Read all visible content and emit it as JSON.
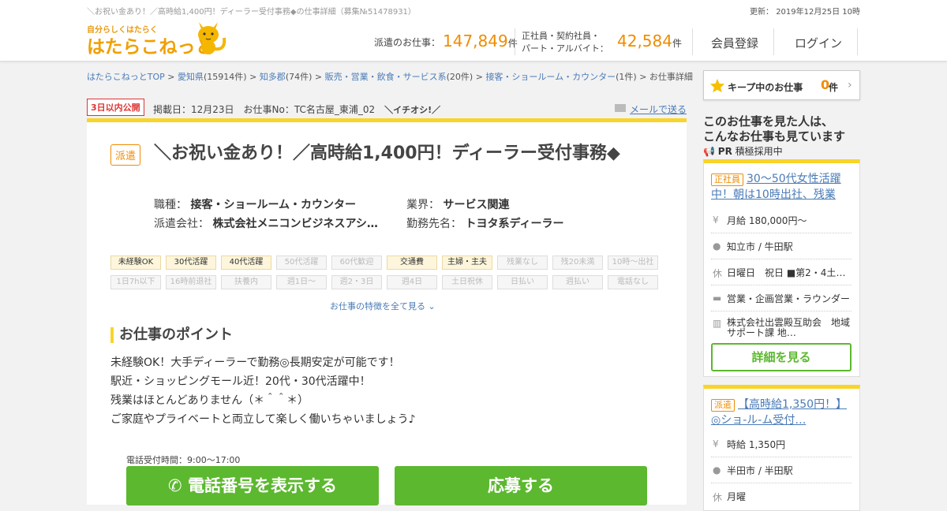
{
  "header": {
    "tagline": "＼お祝い金あり！／高時給1,400円！ディーラー受付事務◆の仕事詳細（募集№51478931）",
    "update": "更新： 2019年12月25日 10時",
    "logo_small": "自分らしくはたらく",
    "logo_big": "はたらこねっと",
    "haken_label": "派遣のお仕事：",
    "haken_count": "147,849",
    "count_unit": "件",
    "seishain_label_1": "正社員・契約社員・",
    "seishain_label_2": "パート・アルバイト：",
    "seishain_count": "42,584",
    "register": "会員登録",
    "login": "ログイン"
  },
  "breadcrumb": {
    "top": "はたらこねっとTOP",
    "pref": "愛知県",
    "pref_count": "(15914件)",
    "area": "知多郡",
    "area_count": "(74件)",
    "cat": "販売・営業・飲食・サービス系",
    "cat_count": "(20件)",
    "sub": "接客・ショールーム・カウンター",
    "sub_count": "(1件)",
    "current": "お仕事詳細",
    "sep": " > "
  },
  "meta": {
    "badge": "3日以内公開",
    "text": "掲載日：12月23日　お仕事No：TC名古屋_東浦_02　",
    "ichioshi": "＼イチオシ!／",
    "mail": "メールで送る"
  },
  "job": {
    "type": "派遣",
    "title": "＼お祝い金あり！／高時給1,400円！ディーラー受付事務◆",
    "shokushu_label": "職種：",
    "shokushu": "接客・ショールーム・カウンター",
    "gyokai_label": "業界：",
    "gyokai": "サービス関連",
    "company_label": "派遣会社：",
    "company": "株式会社メニコンビジネスアシ…",
    "workplace_label": "勤務先名：",
    "workplace": "トヨタ系ディーラー"
  },
  "tags": [
    {
      "label": "未経験OK",
      "on": true
    },
    {
      "label": "30代活躍",
      "on": true
    },
    {
      "label": "40代活躍",
      "on": true
    },
    {
      "label": "50代活躍",
      "on": false
    },
    {
      "label": "60代歓迎",
      "on": false
    },
    {
      "label": "交通費",
      "on": true
    },
    {
      "label": "主婦・主夫",
      "on": true
    },
    {
      "label": "残業なし",
      "on": false
    },
    {
      "label": "残20未満",
      "on": false
    },
    {
      "label": "10時～出社",
      "on": false
    },
    {
      "label": "1日7h以下",
      "on": false
    },
    {
      "label": "16時前退社",
      "on": false
    },
    {
      "label": "扶養内",
      "on": false
    },
    {
      "label": "週1日～",
      "on": false
    },
    {
      "label": "週2・3日",
      "on": false
    },
    {
      "label": "週4日",
      "on": false
    },
    {
      "label": "土日祝休",
      "on": false
    },
    {
      "label": "日払い",
      "on": false
    },
    {
      "label": "週払い",
      "on": false
    },
    {
      "label": "電話なし",
      "on": false
    }
  ],
  "all_tags_link": "お仕事の特徴を全て見る",
  "point": {
    "heading": "お仕事のポイント",
    "lines": [
      "未経験OK！大手ディーラーで勤務◎長期安定が可能です！",
      "駅近・ショッピングモール近！20代・30代活躍中！",
      "残業はほとんどありません（＊＾＾＊）",
      "ご家庭やプライベートと両立して楽しく働いちゃいましょう♪"
    ]
  },
  "actions": {
    "tel_hours": "電話受付時間：9:00～17:00",
    "tel_button": "電話番号を表示する",
    "apply_button": "応募する"
  },
  "sidebar": {
    "keep_label": "キープ中のお仕事",
    "keep_count": "0",
    "keep_unit": "件",
    "seen_line1": "このお仕事を見た人は、",
    "seen_line2": "こんなお仕事も見ています",
    "pr_label": "PR",
    "pr_text": "積極採用中",
    "cards": [
      {
        "badge": "正社員",
        "title": "30～50代女性活躍中！朝は10時出社、残業",
        "salary": "月給 180,000円～",
        "station": "知立市 / 牛田駅",
        "holiday": "日曜日　祝日 ■第2・4土曜…",
        "category": "営業・企画営業・ラウンダー",
        "company": "株式会社出雲殿互助会　地域サポート課 地…",
        "button": "詳細を見る"
      },
      {
        "badge": "派遣",
        "title": "【高時給1,350円！】◎ショ-ル-ム受付…",
        "salary": "時給 1,350円",
        "station": "半田市 / 半田駅",
        "holiday": "月曜"
      }
    ]
  },
  "colors": {
    "accent_orange": "#f08c00",
    "accent_yellow": "#f9d42a",
    "green": "#5cb82f",
    "link_blue": "#4a7bb7"
  }
}
